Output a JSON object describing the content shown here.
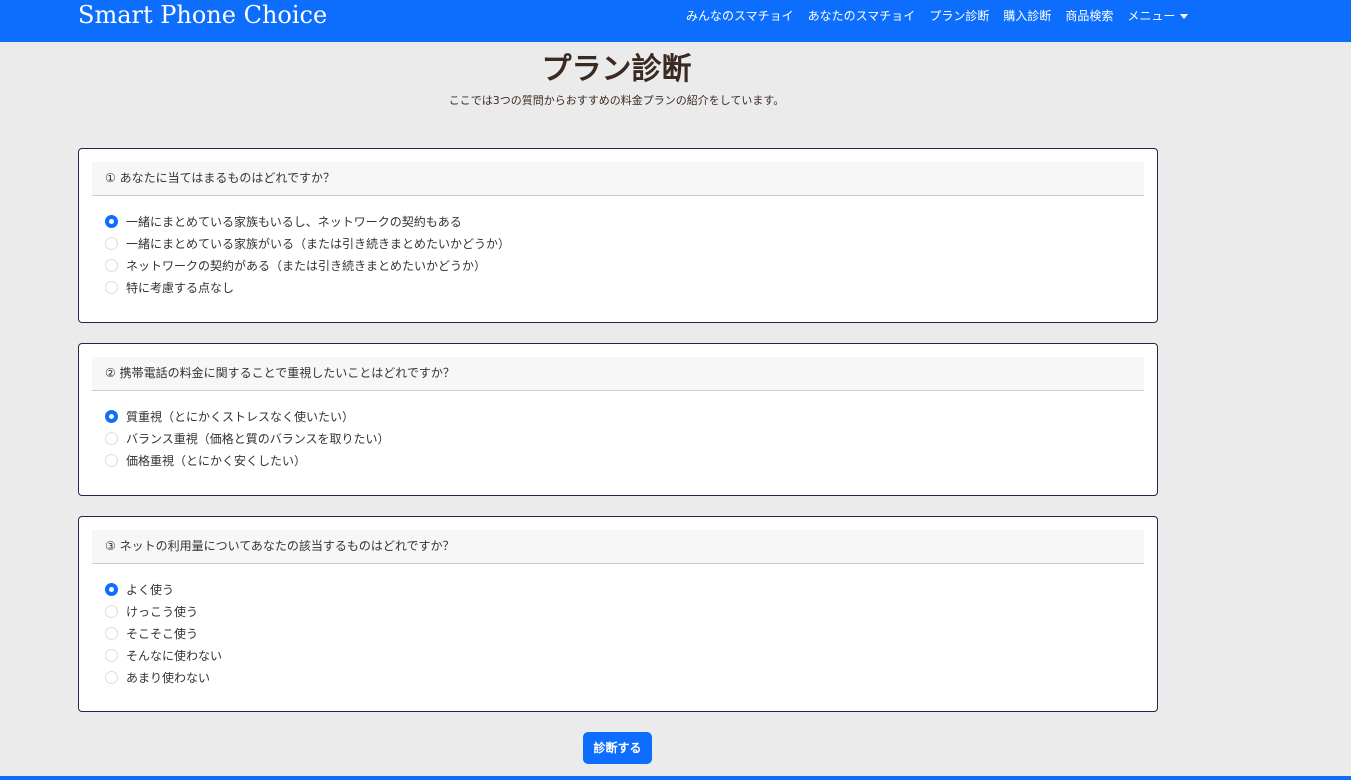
{
  "header": {
    "brand": "Smart Phone Choice",
    "menu": [
      "みんなのスマチョイ",
      "あなたのスマチョイ",
      "プラン診断",
      "購入診断",
      "商品検索"
    ],
    "dropdown": "メニュー"
  },
  "page": {
    "title": "プラン診断",
    "subtitle": "ここでは3つの質問からおすすめの料金プランの紹介をしています。"
  },
  "questions": [
    {
      "title": "① あなたに当てはまるものはどれですか？",
      "options": [
        "一緒にまとめている家族もいるし、ネットワークの契約もある",
        "一緒にまとめている家族がいる（または引き続きまとめたいかどうか）",
        "ネットワークの契約がある（または引き続きまとめたいかどうか）",
        "特に考慮する点なし"
      ],
      "selected": 0
    },
    {
      "title": "② 携帯電話の料金に関することで重視したいことはどれですか？",
      "options": [
        "質重視（とにかくストレスなく使いたい）",
        "バランス重視（価格と質のバランスを取りたい）",
        "価格重視（とにかく安くしたい）"
      ],
      "selected": 0
    },
    {
      "title": "③ ネットの利用量についてあなたの該当するものはどれですか？",
      "options": [
        "よく使う",
        "けっこう使う",
        "そこそこ使う",
        "そんなに使わない",
        "あまり使わない"
      ],
      "selected": 0
    }
  ],
  "submit": "診断する"
}
